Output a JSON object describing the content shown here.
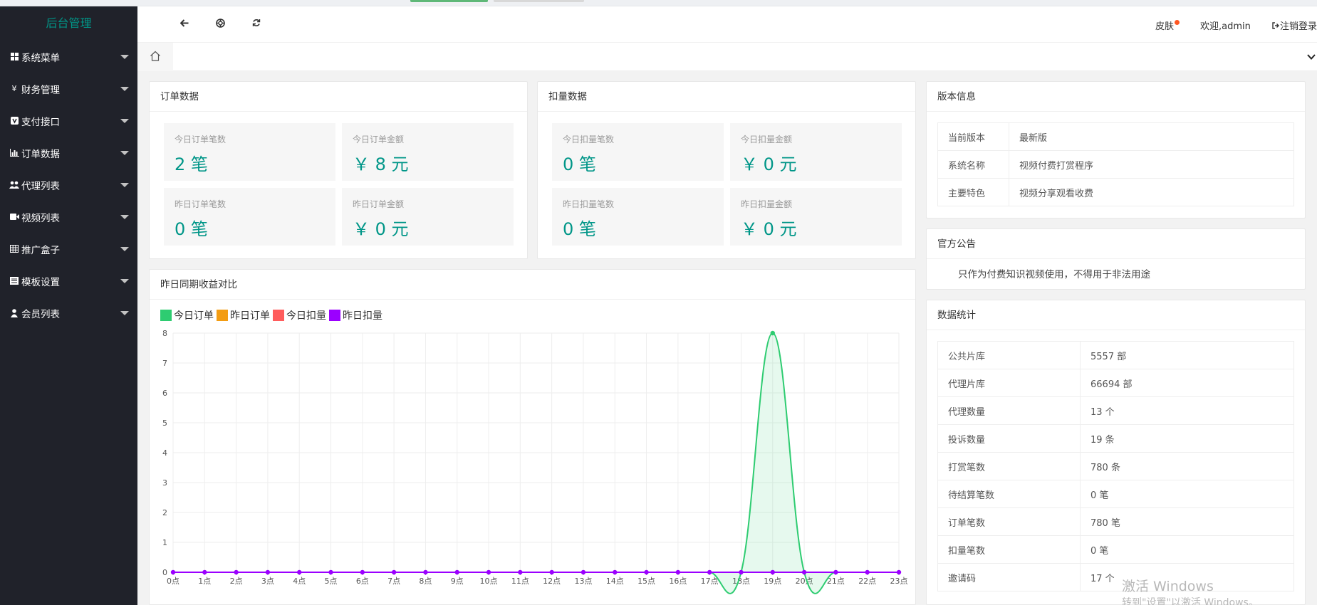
{
  "sidebar": {
    "logo": "后台管理",
    "items": [
      {
        "label": "系统菜单",
        "icon": "grid-icon"
      },
      {
        "label": "财务管理",
        "icon": "yen-icon"
      },
      {
        "label": "支付接口",
        "icon": "v-icon"
      },
      {
        "label": "订单数据",
        "icon": "bar-chart-icon"
      },
      {
        "label": "代理列表",
        "icon": "users-icon"
      },
      {
        "label": "视频列表",
        "icon": "video-icon"
      },
      {
        "label": "推广盒子",
        "icon": "table-icon"
      },
      {
        "label": "模板设置",
        "icon": "list-icon"
      },
      {
        "label": "会员列表",
        "icon": "user-icon"
      }
    ]
  },
  "header": {
    "skin": "皮肤",
    "welcome": "欢迎,admin",
    "logout": "注销登录"
  },
  "order_card": {
    "title": "订单数据",
    "stats": [
      {
        "label": "今日订单笔数",
        "value": "2 笔"
      },
      {
        "label": "今日订单金额",
        "value": "￥ 8 元"
      },
      {
        "label": "昨日订单笔数",
        "value": "0 笔"
      },
      {
        "label": "昨日订单金额",
        "value": "￥ 0 元"
      }
    ]
  },
  "deduct_card": {
    "title": "扣量数据",
    "stats": [
      {
        "label": "今日扣量笔数",
        "value": "0 笔"
      },
      {
        "label": "今日扣量金额",
        "value": "￥ 0 元"
      },
      {
        "label": "昨日扣量笔数",
        "value": "0 笔"
      },
      {
        "label": "昨日扣量金额",
        "value": "￥ 0 元"
      }
    ]
  },
  "version_card": {
    "title": "版本信息",
    "rows": [
      {
        "k": "当前版本",
        "v": "最新版"
      },
      {
        "k": "系统名称",
        "v": "视频付费打赏程序"
      },
      {
        "k": "主要特色",
        "v": "视频分享观看收费"
      }
    ]
  },
  "notice_card": {
    "title": "官方公告",
    "text": "只作为付费知识视频使用，不得用于非法用途"
  },
  "stats_card": {
    "title": "数据统计",
    "rows": [
      {
        "k": "公共片库",
        "v": "5557 部"
      },
      {
        "k": "代理片库",
        "v": "66694 部"
      },
      {
        "k": "代理数量",
        "v": "13 个"
      },
      {
        "k": "投诉数量",
        "v": "19 条"
      },
      {
        "k": "打赏笔数",
        "v": "780 条"
      },
      {
        "k": "待结算笔数",
        "v": "0 笔"
      },
      {
        "k": "订单笔数",
        "v": "780 笔"
      },
      {
        "k": "扣量笔数",
        "v": "0 笔"
      },
      {
        "k": "邀请码",
        "v": "17 个"
      }
    ]
  },
  "chart_card": {
    "title": "昨日同期收益对比"
  },
  "chart_data": {
    "type": "line",
    "title": "昨日同期收益对比",
    "categories": [
      "0点",
      "1点",
      "2点",
      "3点",
      "4点",
      "5点",
      "6点",
      "7点",
      "8点",
      "9点",
      "10点",
      "11点",
      "12点",
      "13点",
      "14点",
      "15点",
      "16点",
      "17点",
      "18点",
      "19点",
      "20点",
      "21点",
      "22点",
      "23点"
    ],
    "series": [
      {
        "name": "今日订单",
        "color": "#2ecc71",
        "values": [
          0,
          0,
          0,
          0,
          0,
          0,
          0,
          0,
          0,
          0,
          0,
          0,
          0,
          0,
          0,
          0,
          0,
          0,
          0,
          8,
          0,
          0,
          0,
          0
        ]
      },
      {
        "name": "昨日订单",
        "color": "#f39c12",
        "values": [
          0,
          0,
          0,
          0,
          0,
          0,
          0,
          0,
          0,
          0,
          0,
          0,
          0,
          0,
          0,
          0,
          0,
          0,
          0,
          0,
          0,
          0,
          0,
          0
        ]
      },
      {
        "name": "今日扣量",
        "color": "#ff5c5c",
        "values": [
          0,
          0,
          0,
          0,
          0,
          0,
          0,
          0,
          0,
          0,
          0,
          0,
          0,
          0,
          0,
          0,
          0,
          0,
          0,
          0,
          0,
          0,
          0,
          0
        ]
      },
      {
        "name": "昨日扣量",
        "color": "#9b00ff",
        "values": [
          0,
          0,
          0,
          0,
          0,
          0,
          0,
          0,
          0,
          0,
          0,
          0,
          0,
          0,
          0,
          0,
          0,
          0,
          0,
          0,
          0,
          0,
          0,
          0
        ]
      }
    ],
    "ylim": [
      0,
      8
    ],
    "yticks": [
      "0",
      "1",
      "2",
      "3",
      "4",
      "5",
      "6",
      "7",
      "8"
    ],
    "grid": true,
    "legend": "top-left"
  },
  "watermark": {
    "line1": "激活 Windows",
    "line2": "转到\"设置\"以激活 Windows。"
  }
}
